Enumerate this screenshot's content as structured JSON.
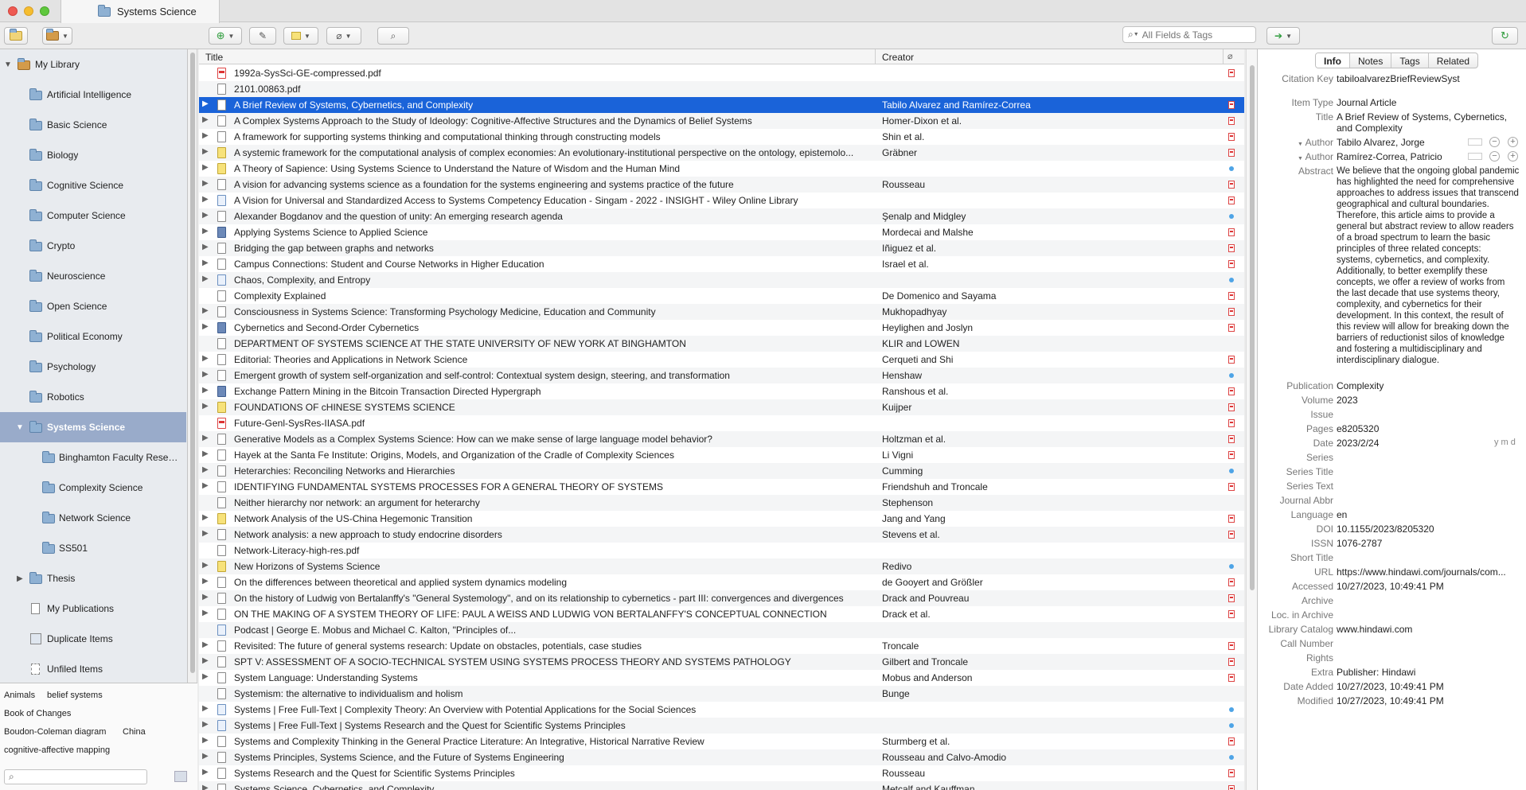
{
  "window": {
    "tab_title": "Systems Science"
  },
  "toolbar": {
    "search_placeholder": "All Fields & Tags"
  },
  "sidebar": {
    "library": "My Library",
    "collections": [
      "Artificial Intelligence",
      "Basic Science",
      "Biology",
      "Cognitive Science",
      "Computer Science",
      "Crypto",
      "Neuroscience",
      "Open Science",
      "Political Economy",
      "Psychology",
      "Robotics"
    ],
    "selected": "Systems Science",
    "subcollections": [
      "Binghamton Faculty Resea...",
      "Complexity Science",
      "Network Science",
      "SS501"
    ],
    "thesis": "Thesis",
    "extra": [
      "My Publications",
      "Duplicate Items",
      "Unfiled Items"
    ]
  },
  "tags": {
    "row1_a": "Animals",
    "row1_b": "belief systems",
    "row2": "Book of Changes",
    "row3_a": "Boudon-Coleman diagram",
    "row3_b": "China",
    "row4": "cognitive-affective mapping"
  },
  "columns": {
    "title": "Title",
    "creator": "Creator"
  },
  "items": [
    {
      "t": "1992a-SysSci-GE-compressed.pdf",
      "c": "",
      "i": "pdf",
      "a": "pdf",
      "e": false
    },
    {
      "t": "2101.00863.pdf",
      "c": "",
      "i": "doc",
      "a": "",
      "e": false
    },
    {
      "t": "A Brief Review of Systems, Cybernetics, and Complexity",
      "c": "Tabilo Alvarez and Ramírez-Correa",
      "i": "doc",
      "a": "pdf",
      "e": true
    },
    {
      "t": "A Complex Systems Approach to the Study of Ideology: Cognitive-Affective Structures and the Dynamics of Belief Systems",
      "c": "Homer-Dixon et al.",
      "i": "doc",
      "a": "pdf",
      "e": true
    },
    {
      "t": "A framework for supporting systems thinking and computational thinking through constructing models",
      "c": "Shin et al.",
      "i": "doc",
      "a": "pdf",
      "e": true
    },
    {
      "t": "A systemic framework for the computational analysis of complex economies: An evolutionary-institutional perspective on the ontology, epistemolo...",
      "c": "Gräbner",
      "i": "note",
      "a": "pdf",
      "e": true
    },
    {
      "t": "A Theory of Sapience: Using Systems Science to Understand the Nature of Wisdom and the Human Mind",
      "c": "",
      "i": "note",
      "a": "link",
      "e": true
    },
    {
      "t": "A vision for advancing systems science as a foundation for the systems engineering and systems practice of the future",
      "c": "Rousseau",
      "i": "doc",
      "a": "pdf",
      "e": true
    },
    {
      "t": "A Vision for Universal and Standardized Access to Systems Competency Education - Singam - 2022 - INSIGHT - Wiley Online Library",
      "c": "",
      "i": "web",
      "a": "pdf",
      "e": true
    },
    {
      "t": "Alexander Bogdanov and the question of unity: An emerging research agenda",
      "c": "Şenalp and Midgley",
      "i": "doc",
      "a": "link",
      "e": true
    },
    {
      "t": "Applying Systems Science to Applied Science",
      "c": "Mordecai and Malshe",
      "i": "book",
      "a": "pdf",
      "e": true
    },
    {
      "t": "Bridging the gap between graphs and networks",
      "c": "Iñiguez et al.",
      "i": "doc",
      "a": "pdf",
      "e": true
    },
    {
      "t": "Campus Connections: Student and Course Networks in Higher Education",
      "c": "Israel et al.",
      "i": "doc",
      "a": "pdf",
      "e": true
    },
    {
      "t": "Chaos, Complexity, and Entropy",
      "c": "",
      "i": "web",
      "a": "link",
      "e": true
    },
    {
      "t": "Complexity Explained",
      "c": "De Domenico and Sayama",
      "i": "doc",
      "a": "pdf",
      "e": false
    },
    {
      "t": "Consciousness in Systems Science: Transforming Psychology Medicine, Education and Community",
      "c": "Mukhopadhyay",
      "i": "doc",
      "a": "pdf",
      "e": true
    },
    {
      "t": "Cybernetics and Second-Order Cybernetics",
      "c": "Heylighen and Joslyn",
      "i": "book",
      "a": "pdf",
      "e": true
    },
    {
      "t": "DEPARTMENT OF SYSTEMS SCIENCE AT THE STATE UNIVERSITY OF NEW YORK AT BINGHAMTON",
      "c": "KLIR and LOWEN",
      "i": "doc",
      "a": "",
      "e": false
    },
    {
      "t": "Editorial: Theories and Applications in Network Science",
      "c": "Cerqueti and Shi",
      "i": "doc",
      "a": "pdf",
      "e": true
    },
    {
      "t": "Emergent growth of system self-organization and self-control: Contextual system design, steering, and transformation",
      "c": "Henshaw",
      "i": "doc",
      "a": "link",
      "e": true
    },
    {
      "t": "Exchange Pattern Mining in the Bitcoin Transaction Directed Hypergraph",
      "c": "Ranshous et al.",
      "i": "book",
      "a": "pdf",
      "e": true
    },
    {
      "t": "FOUNDATIONS OF cHINESE SYSTEMS SCIENCE",
      "c": "Kuijper",
      "i": "note",
      "a": "pdf",
      "e": true
    },
    {
      "t": "Future-Genl-SysRes-IIASA.pdf",
      "c": "",
      "i": "pdf",
      "a": "pdf",
      "e": false
    },
    {
      "t": "Generative Models as a Complex Systems Science: How can we make sense of large language model behavior?",
      "c": "Holtzman et al.",
      "i": "doc",
      "a": "pdf",
      "e": true
    },
    {
      "t": "Hayek at the Santa Fe Institute: Origins, Models, and Organization of the Cradle of Complexity Sciences",
      "c": "Li Vigni",
      "i": "doc",
      "a": "pdf",
      "e": true
    },
    {
      "t": "Heterarchies: Reconciling Networks and Hierarchies",
      "c": "Cumming",
      "i": "doc",
      "a": "link",
      "e": true
    },
    {
      "t": "IDENTIFYING FUNDAMENTAL SYSTEMS PROCESSES FOR A GENERAL THEORY OF SYSTEMS",
      "c": "Friendshuh and Troncale",
      "i": "doc",
      "a": "pdf",
      "e": true
    },
    {
      "t": "Neither hierarchy nor network: an argument for heterarchy",
      "c": "Stephenson",
      "i": "doc",
      "a": "",
      "e": false
    },
    {
      "t": "Network Analysis of the US-China Hegemonic Transition",
      "c": "Jang and Yang",
      "i": "note",
      "a": "pdf",
      "e": true
    },
    {
      "t": "Network analysis: a new approach to study endocrine disorders",
      "c": "Stevens et al.",
      "i": "doc",
      "a": "pdf",
      "e": true
    },
    {
      "t": "Network-Literacy-high-res.pdf",
      "c": "",
      "i": "doc",
      "a": "",
      "e": false
    },
    {
      "t": "New Horizons of Systems Science",
      "c": "Redivo",
      "i": "note",
      "a": "link",
      "e": true
    },
    {
      "t": "On the differences between theoretical and applied system dynamics modeling",
      "c": "de Gooyert and Größler",
      "i": "doc",
      "a": "pdf",
      "e": true
    },
    {
      "t": "On the history of Ludwig von Bertalanffy's \"General Systemology\", and on its relationship to cybernetics - part III: convergences and divergences",
      "c": "Drack and Pouvreau",
      "i": "doc",
      "a": "pdf",
      "e": true
    },
    {
      "t": "ON THE MAKING OF A SYSTEM THEORY OF LIFE: PAUL A WEISS AND LUDWIG VON BERTALANFFY'S CONCEPTUAL CONNECTION",
      "c": "Drack et al.",
      "i": "doc",
      "a": "pdf",
      "e": true
    },
    {
      "t": "Podcast | George E. Mobus and Michael C. Kalton, \"Principles of...",
      "c": "",
      "i": "web",
      "a": "",
      "e": false
    },
    {
      "t": "Revisited: The future of general systems research: Update on obstacles, potentials, case studies",
      "c": "Troncale",
      "i": "doc",
      "a": "pdf",
      "e": true
    },
    {
      "t": "SPT V: ASSESSMENT OF A SOCIO-TECHNICAL SYSTEM USING SYSTEMS PROCESS THEORY AND SYSTEMS PATHOLOGY",
      "c": "Gilbert and Troncale",
      "i": "doc",
      "a": "pdf",
      "e": true
    },
    {
      "t": "System Language: Understanding Systems",
      "c": "Mobus and Anderson",
      "i": "doc",
      "a": "pdf",
      "e": true
    },
    {
      "t": "Systemism: the alternative to individualism and holism",
      "c": "Bunge",
      "i": "doc",
      "a": "",
      "e": false
    },
    {
      "t": "Systems | Free Full-Text | Complexity Theory: An Overview with Potential Applications for the Social Sciences",
      "c": "",
      "i": "web",
      "a": "link",
      "e": true
    },
    {
      "t": "Systems | Free Full-Text | Systems Research and the Quest for Scientific Systems Principles",
      "c": "",
      "i": "web",
      "a": "link",
      "e": true
    },
    {
      "t": "Systems and Complexity Thinking in the General Practice Literature: An Integrative, Historical Narrative Review",
      "c": "Sturmberg et al.",
      "i": "doc",
      "a": "pdf",
      "e": true
    },
    {
      "t": "Systems Principles, Systems Science, and the Future of Systems Engineering",
      "c": "Rousseau and Calvo-Amodio",
      "i": "doc",
      "a": "link",
      "e": true
    },
    {
      "t": "Systems Research and the Quest for Scientific Systems Principles",
      "c": "Rousseau",
      "i": "doc",
      "a": "pdf",
      "e": true
    },
    {
      "t": "Systems Science, Cybernetics, and Complexity",
      "c": "Metcalf and Kauffman",
      "i": "doc",
      "a": "pdf",
      "e": true
    }
  ],
  "info": {
    "tabs": [
      "Info",
      "Notes",
      "Tags",
      "Related"
    ],
    "citation_key_label": "Citation Key",
    "citation_key": "tabiloalvarezBriefReviewSyst",
    "item_type_label": "Item Type",
    "item_type": "Journal Article",
    "title_label": "Title",
    "title": "A Brief Review of Systems, Cybernetics, and Complexity",
    "author_label": "Author",
    "author1": "Tabilo Alvarez, Jorge",
    "author2": "Ramírez-Correa, Patricio",
    "abstract_label": "Abstract",
    "abstract": "We believe that the ongoing global pandemic has highlighted the need for comprehensive approaches to address issues that transcend geographical and cultural boundaries. Therefore, this article aims to provide a general but abstract review to allow readers of a broad spectrum to learn the basic principles of three related concepts: systems, cybernetics, and complexity. Additionally, to better exemplify these concepts, we offer a review of works from the last decade that use systems theory, complexity, and cybernetics for their development. In this context, the result of this review will allow for breaking down the barriers of reductionist silos of knowledge and fostering a multidisciplinary and interdisciplinary dialogue.",
    "publication_label": "Publication",
    "publication": "Complexity",
    "volume_label": "Volume",
    "volume": "2023",
    "issue_label": "Issue",
    "pages_label": "Pages",
    "pages": "e8205320",
    "date_label": "Date",
    "date": "2023/2/24",
    "date_hint": "y m d",
    "series_label": "Series",
    "series_title_label": "Series Title",
    "series_text_label": "Series Text",
    "journal_abbr_label": "Journal Abbr",
    "language_label": "Language",
    "language": "en",
    "doi_label": "DOI",
    "doi": "10.1155/2023/8205320",
    "issn_label": "ISSN",
    "issn": "1076-2787",
    "short_title_label": "Short Title",
    "url_label": "URL",
    "url": "https://www.hindawi.com/journals/com...",
    "accessed_label": "Accessed",
    "accessed": "10/27/2023, 10:49:41 PM",
    "archive_label": "Archive",
    "loc_label": "Loc. in Archive",
    "catalog_label": "Library Catalog",
    "catalog": "www.hindawi.com",
    "call_number_label": "Call Number",
    "rights_label": "Rights",
    "extra_label": "Extra",
    "extra": "Publisher: Hindawi",
    "date_added_label": "Date Added",
    "date_added": "10/27/2023, 10:49:41 PM",
    "modified_label": "Modified",
    "modified": "10/27/2023, 10:49:41 PM"
  }
}
